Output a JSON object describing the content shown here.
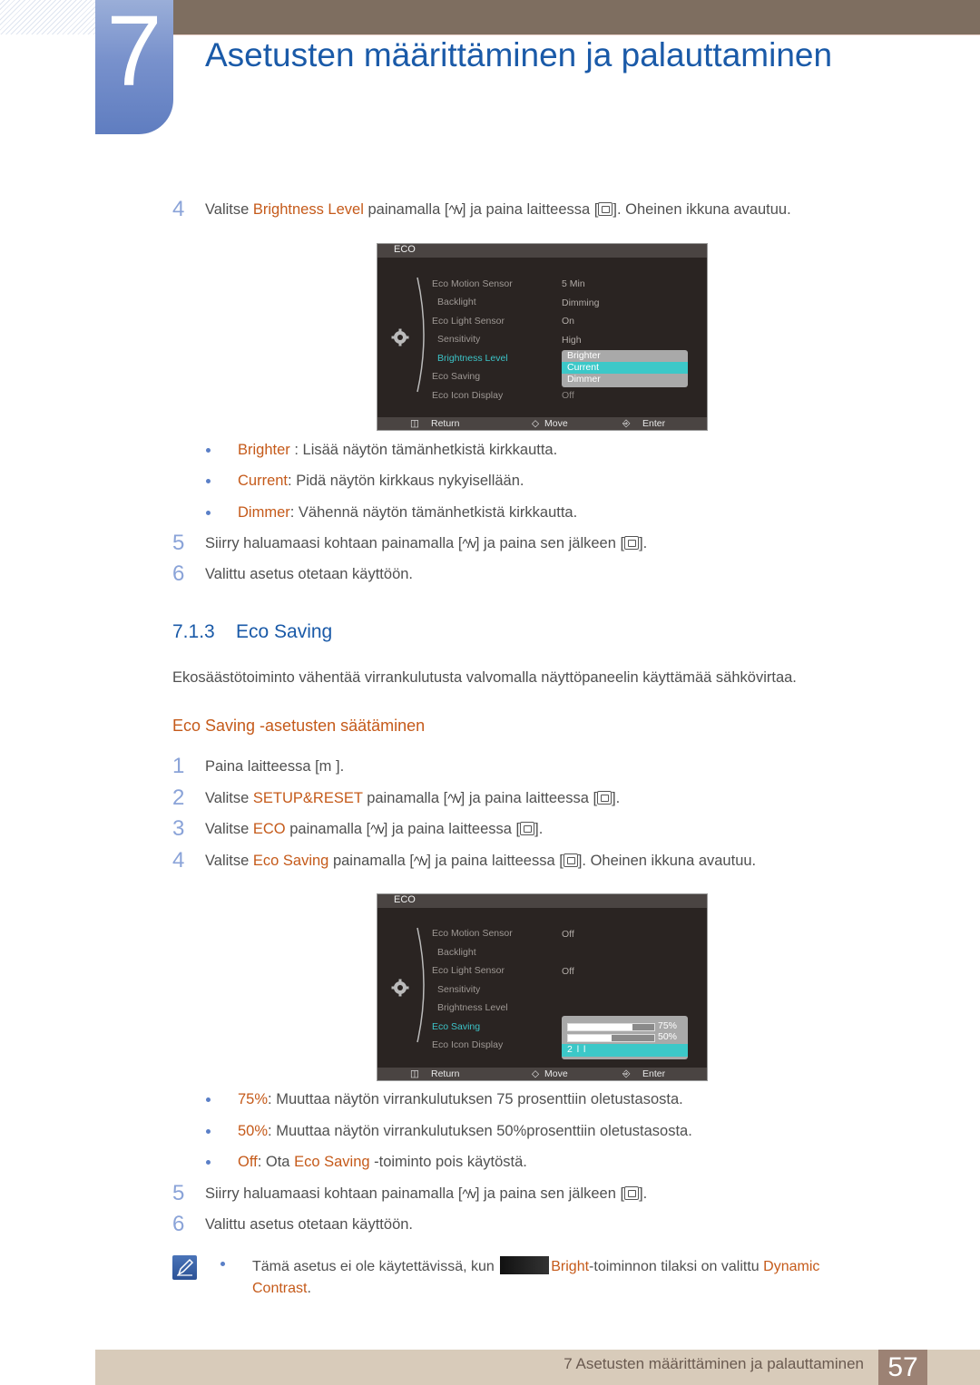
{
  "chapter": {
    "number": "7",
    "title": "Asetusten määrittäminen ja palauttaminen"
  },
  "brightness_steps": {
    "step4": {
      "num": "4",
      "prefix": "Valitse ",
      "highlight": "Brightness Level",
      "middle": " painamalla [",
      "keys": "^/v",
      "after_keys": "] ja paina laitteessa [",
      "suffix": "]. Oheinen ikkuna avautuu."
    },
    "options": [
      {
        "term": "Brighter",
        "desc": " : Lisää näytön tämänhetkistä kirkkautta."
      },
      {
        "term": "Current",
        "desc": ": Pidä näytön kirkkaus nykyisellään."
      },
      {
        "term": "Dimmer",
        "desc": ": Vähennä näytön tämänhetkistä kirkkautta."
      }
    ],
    "step5": {
      "num": "5",
      "prefix": "Siirry haluamaasi kohtaan painamalla [",
      "keys": "^/v",
      "middle": "] ja paina sen jälkeen [",
      "suffix": "]."
    },
    "step6": {
      "num": "6",
      "text": "Valittu asetus otetaan käyttöön."
    }
  },
  "osd1": {
    "title": "ECO",
    "items": [
      "Eco Motion Sensor",
      "Backlight",
      "Eco Light Sensor",
      "Sensitivity",
      "Brightness Level",
      "Eco Saving",
      "Eco Icon Display"
    ],
    "values": [
      "5 Min",
      "Dimming",
      "On",
      "High",
      "",
      "",
      "Off"
    ],
    "active_item": "Brightness Level",
    "popup_options": [
      "Brighter",
      "Current",
      "Dimmer"
    ],
    "popup_selected": "Current",
    "footer": {
      "return": "Return",
      "move": "Move",
      "enter": "Enter"
    }
  },
  "section": {
    "number": "7.1.3",
    "title": "Eco Saving",
    "description": "Ekosäästötoiminto vähentää virrankulutusta valvomalla näyttöpaneelin käyttämää sähkövirtaa.",
    "subheading": "Eco Saving -asetusten säätäminen"
  },
  "eco_steps": {
    "step1": {
      "num": "1",
      "text": "Paina laitteessa [m   ]."
    },
    "step2": {
      "num": "2",
      "prefix": "Valitse ",
      "highlight": "SETUP&RESET",
      "middle": " painamalla [",
      "keys": "^/v",
      "after_keys": "] ja paina laitteessa [",
      "suffix": "]."
    },
    "step3": {
      "num": "3",
      "prefix": "Valitse ",
      "highlight": "ECO",
      "middle": " painamalla [",
      "keys": "^/v",
      "after_keys": "] ja paina laitteessa [",
      "suffix": "]."
    },
    "step4": {
      "num": "4",
      "prefix": "Valitse ",
      "highlight": "Eco Saving",
      "middle": " painamalla [",
      "keys": "^/v",
      "after_keys": "] ja paina laitteessa [",
      "suffix": "]. Oheinen ikkuna avautuu."
    },
    "options": [
      {
        "term": "75%",
        "desc": ": Muuttaa näytön virrankulutuksen 75 prosenttiin oletustasosta."
      },
      {
        "term": "50%",
        "desc": ": Muuttaa näytön virrankulutuksen 50%prosenttiin oletustasosta."
      },
      {
        "term": "Off",
        "desc": ": Ota ",
        "term2": "Eco Saving",
        "desc2": " -toiminto pois käytöstä."
      }
    ],
    "step5": {
      "num": "5",
      "prefix": "Siirry haluamaasi kohtaan painamalla [",
      "keys": "^/v",
      "middle": "] ja paina sen jälkeen [",
      "suffix": "]."
    },
    "step6": {
      "num": "6",
      "text": "Valittu asetus otetaan käyttöön."
    }
  },
  "osd2": {
    "title": "ECO",
    "items": [
      "Eco Motion Sensor",
      "Backlight",
      "Eco Light Sensor",
      "Sensitivity",
      "Brightness Level",
      "Eco Saving",
      "Eco Icon Display"
    ],
    "values": [
      "Off",
      "",
      "Off",
      "",
      "",
      "",
      ""
    ],
    "active_item": "Eco Saving",
    "popup_options": [
      {
        "label": "75%",
        "fill_percent": 75
      },
      {
        "label": "50%",
        "fill_percent": 50
      },
      {
        "label": "2 l l"
      }
    ],
    "popup_selected": "2 l l",
    "footer": {
      "return": "Return",
      "move": "Move",
      "enter": "Enter"
    }
  },
  "note": {
    "prefix": "Tämä asetus ei ole käytettävissä, kun ",
    "highlight1": "Bright",
    "middle": "-toiminnon tilaksi on valittu ",
    "highlight2a": "Dynamic",
    "highlight2b": "Contrast",
    "suffix": "."
  },
  "footer": {
    "title": "7 Asetusten määrittäminen ja palauttaminen",
    "page": "57"
  }
}
